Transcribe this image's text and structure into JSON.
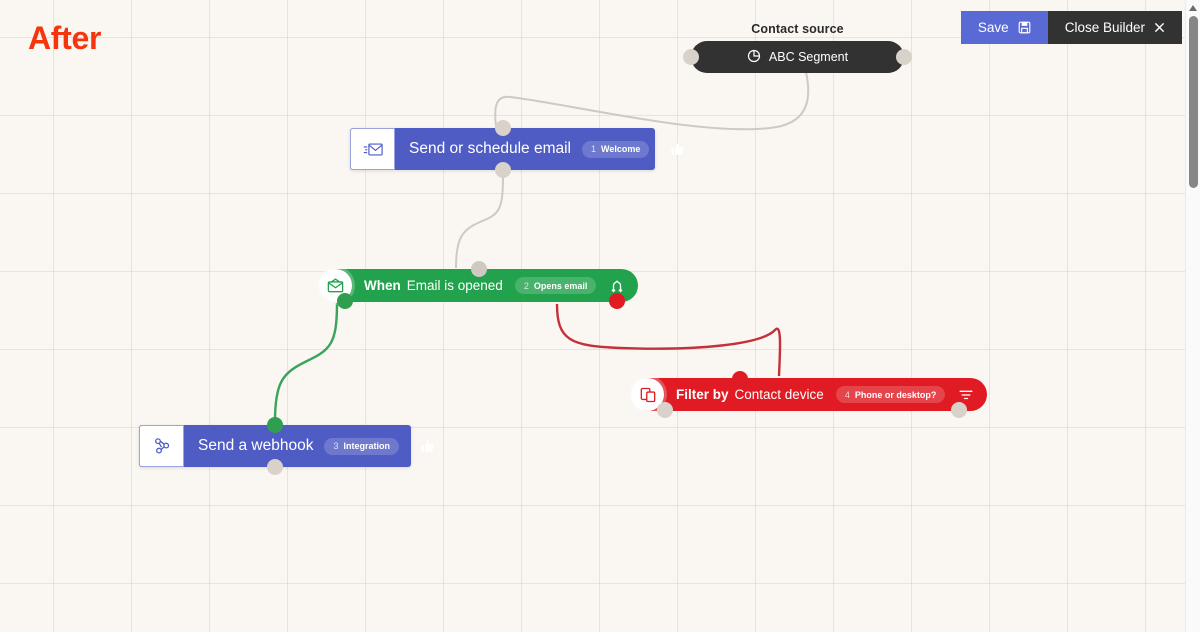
{
  "annotation": {
    "label": "After",
    "color": "#f4350d"
  },
  "toolbar": {
    "save_label": "Save",
    "save_icon": "save-disk-icon",
    "save_color": "#5a6ad4",
    "close_label": "Close Builder",
    "close_icon": "close-x-icon",
    "close_color": "#333232"
  },
  "source": {
    "label": "Contact source",
    "name": "ABC Segment",
    "icon": "pie-chart-icon",
    "color": "#333232"
  },
  "nodes": [
    {
      "id": "send-email",
      "type": "action",
      "title": "Send or schedule email",
      "icon": "send-email-icon",
      "badge_num": "1",
      "badge_text": "Welcome",
      "trail_icon": "thumbs-up-icon",
      "color": "#4f5cc4"
    },
    {
      "id": "email-opened",
      "type": "trigger",
      "prefix": "When",
      "title": "Email is opened",
      "icon": "open-envelope-icon",
      "badge_num": "2",
      "badge_text": "Opens email",
      "trail_icon": "split-branch-icon",
      "color": "#22a24c"
    },
    {
      "id": "send-webhook",
      "type": "action",
      "title": "Send a webhook",
      "icon": "webhook-icon",
      "badge_num": "3",
      "badge_text": "Integration",
      "trail_icon": "thumbs-up-icon",
      "color": "#4f5cc4"
    },
    {
      "id": "filter-device",
      "type": "filter",
      "prefix": "Filter by",
      "title": "Contact device",
      "icon": "devices-icon",
      "badge_num": "4",
      "badge_text": "Phone or desktop?",
      "trail_icon": "funnel-icon",
      "color": "#e01b24"
    }
  ],
  "edges": [
    {
      "id": "source-to-email",
      "color": "#cfc9c1",
      "from": "ABC Segment",
      "to": "Send or schedule email"
    },
    {
      "id": "email-to-trigger",
      "color": "#cfc9c1",
      "from": "Send or schedule email",
      "to": "Email is opened"
    },
    {
      "id": "trigger-yes",
      "color": "#3aa35c",
      "from": "Email is opened",
      "to": "Send a webhook"
    },
    {
      "id": "trigger-no",
      "color": "#c4313a",
      "from": "Email is opened",
      "to": "Contact device"
    }
  ],
  "canvas": {
    "background": "#faf6f1",
    "grid": "plus-marks"
  },
  "scrollbar": {
    "position": "right",
    "thumb_color": "#868686"
  }
}
